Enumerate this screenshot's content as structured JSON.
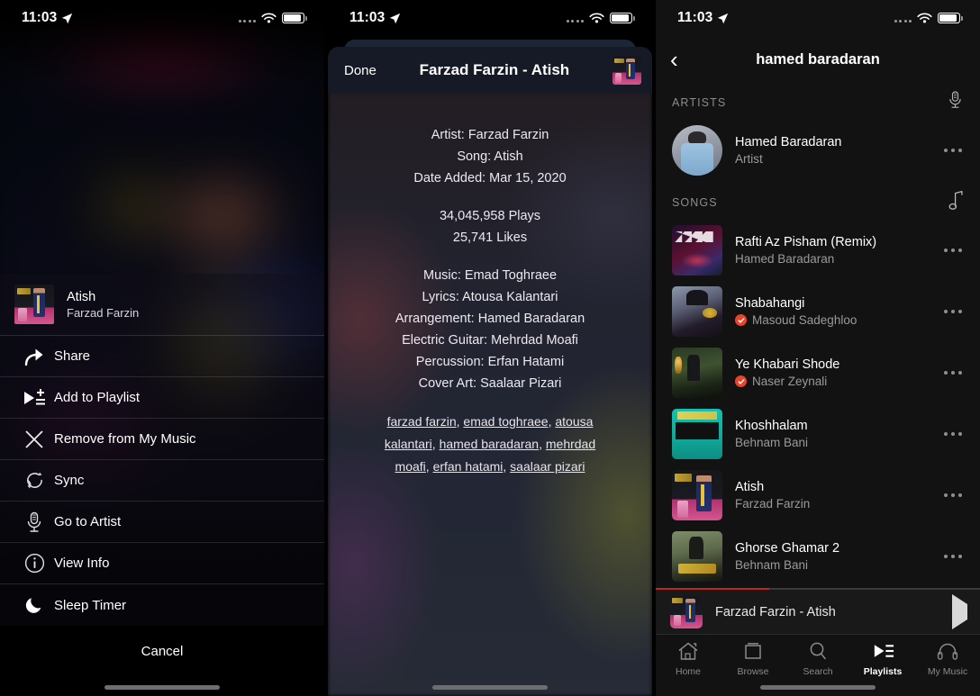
{
  "status_bar": {
    "time": "11:03",
    "location_icon": "location-arrow-icon",
    "wifi_icon": "wifi-icon",
    "battery_icon": "battery-icon"
  },
  "panel1": {
    "name": "now-playing-action-sheet",
    "now_playing": {
      "title": "Atish",
      "artist": "Farzad Farzin",
      "artwork": "atish-album-art"
    },
    "actions": [
      {
        "icon": "share-icon",
        "label": "Share"
      },
      {
        "icon": "add-to-playlist-icon",
        "label": "Add to Playlist"
      },
      {
        "icon": "close-x-icon",
        "label": "Remove from My Music"
      },
      {
        "icon": "sync-refresh-icon",
        "label": "Sync"
      },
      {
        "icon": "microphone-icon",
        "label": "Go to Artist"
      },
      {
        "icon": "info-circle-icon",
        "label": "View Info"
      },
      {
        "icon": "moon-icon",
        "label": "Sleep Timer"
      }
    ],
    "cancel_label": "Cancel"
  },
  "panel2": {
    "name": "song-info-modal",
    "nav": {
      "done_label": "Done",
      "title": "Farzad Farzin - Atish",
      "thumb": "atish-album-art"
    },
    "info_lines": [
      "Artist: Farzad Farzin",
      "Song: Atish",
      "Date Added: Mar 15, 2020"
    ],
    "stats": [
      "34,045,958 Plays",
      "25,741 Likes"
    ],
    "credits": [
      "Music: Emad Toghraee",
      "Lyrics: Atousa Kalantari",
      "Arrangement: Hamed Baradaran",
      "Electric Guitar: Mehrdad Moafi",
      "Percussion: Erfan Hatami",
      "Cover Art: Saalaar Pizari"
    ],
    "tags": [
      "farzad farzin",
      "emad toghraee",
      "atousa kalantari",
      "hamed baradaran",
      "mehrdad moafi",
      "erfan hatami",
      "saalaar pizari"
    ]
  },
  "panel3": {
    "name": "search-results-screen",
    "nav": {
      "back_icon": "chevron-left-icon",
      "title": "hamed baradaran"
    },
    "sections": [
      {
        "label": "ARTISTS",
        "icon": "microphone-icon"
      },
      {
        "label": "SONGS",
        "icon": "music-note-icon"
      }
    ],
    "artists": [
      {
        "name": "Hamed Baradaran",
        "subtitle": "Artist",
        "artwork": "cv-artist",
        "verified": false
      }
    ],
    "songs": [
      {
        "title": "Rafti Az Pisham (Remix)",
        "artist": "Hamed Baradaran",
        "artwork": "cv-hamed",
        "verified": false
      },
      {
        "title": "Shabahangi",
        "artist": "Masoud Sadeghloo",
        "artwork": "cv-masoud",
        "verified": true
      },
      {
        "title": "Ye Khabari Shode",
        "artist": "Naser Zeynali",
        "artwork": "cv-naser",
        "verified": true
      },
      {
        "title": "Khoshhalam",
        "artist": "Behnam Bani",
        "artwork": "cv-behnam",
        "verified": false
      },
      {
        "title": "Atish",
        "artist": "Farzad Farzin",
        "artwork": "atish",
        "verified": false
      },
      {
        "title": "Ghorse Ghamar 2",
        "artist": "Behnam Bani",
        "artwork": "cv-ghorse",
        "verified": false
      }
    ],
    "mini_player": {
      "title": "Farzad Farzin - Atish",
      "artwork": "atish-album-art",
      "play_icon": "play-icon",
      "progress_percent": 35
    },
    "tabs": [
      {
        "label": "Home",
        "icon": "home-icon",
        "active": false
      },
      {
        "label": "Browse",
        "icon": "browse-icon",
        "active": false
      },
      {
        "label": "Search",
        "icon": "search-icon",
        "active": false
      },
      {
        "label": "Playlists",
        "icon": "playlist-icon",
        "active": true
      },
      {
        "label": "My Music",
        "icon": "headphones-icon",
        "active": false
      }
    ]
  },
  "colors": {
    "accent_red": "#c1271c",
    "verified_badge": "#e8442a",
    "bg_dark": "#121212",
    "mini_player_bg": "#191919"
  }
}
